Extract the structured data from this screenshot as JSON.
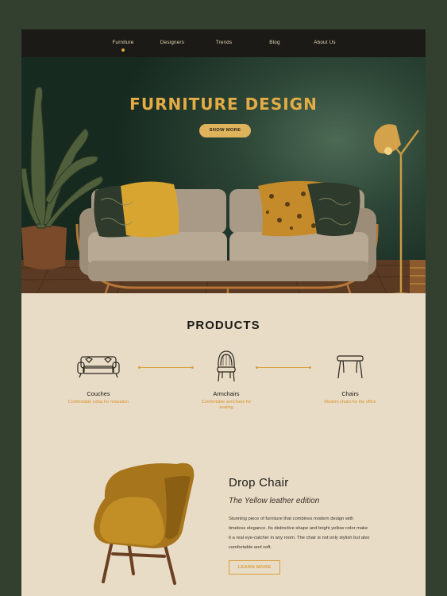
{
  "nav": {
    "items": [
      "Furniture",
      "Designers",
      "Trends",
      "Blog",
      "About Us"
    ],
    "active_index": 0
  },
  "hero": {
    "title": "FURNITURE DESIGN",
    "button_label": "SHOW MORE"
  },
  "products": {
    "title": "PRODUCTS",
    "items": [
      {
        "icon": "sofa-icon",
        "name": "Couches",
        "desc": "Comfortable sofas for relaxation"
      },
      {
        "icon": "armchair-icon",
        "name": "Armchairs",
        "desc": "Comfortable armchairs for seating"
      },
      {
        "icon": "chair-icon",
        "name": "Chairs",
        "desc": "Modern chairs for the office"
      }
    ]
  },
  "feature": {
    "title": "Drop Chair",
    "subtitle": "The Yellow leather edition",
    "body": "Stunning piece of furniture that combines modern design with timeless elegance. Its distinctive shape and bright yellow color make it a real eye-catcher in any room. The chair is not only stylish but also comfortable and soft.",
    "button_label": "LEARN MORE"
  },
  "colors": {
    "accent": "#e3ac44",
    "background": "#e8dcc6",
    "nav_bg": "#1c1a16",
    "outer_bg": "#33402f"
  }
}
